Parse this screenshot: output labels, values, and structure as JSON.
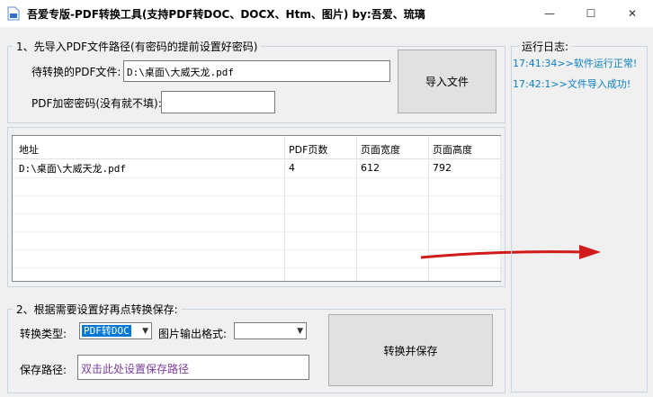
{
  "window": {
    "title": "吾爱专版-PDF转换工具(支持PDF转DOC、DOCX、Htm、图片) by:吾爱、琉璃",
    "minimize_glyph": "—",
    "maximize_glyph": "☐",
    "close_glyph": "✕"
  },
  "import_group": {
    "title": "1、先导入PDF文件路径(有密码的提前设置好密码)",
    "file_label": "待转换的PDF文件:",
    "file_value": "D:\\桌面\\大威天龙.pdf",
    "password_label": "PDF加密密码(没有就不填):",
    "password_value": "",
    "import_button": "导入文件"
  },
  "file_table": {
    "columns": [
      "地址",
      "PDF页数",
      "页面宽度",
      "页面高度"
    ],
    "rows": [
      [
        "D:\\桌面\\大威天龙.pdf",
        "4",
        "612",
        "792"
      ]
    ]
  },
  "convert_group": {
    "title": "2、根据需要设置好再点转换保存:",
    "type_label": "转换类型:",
    "type_value": "PDF转DOC",
    "image_format_label": "图片输出格式:",
    "image_format_value": "",
    "save_label": "保存路径:",
    "save_value": "双击此处设置保存路径",
    "convert_button": "转换并保存"
  },
  "log_group": {
    "title": "运行日志:",
    "lines": [
      "17:41:34>>软件运行正常!",
      "17:42:1>>文件导入成功!"
    ]
  },
  "colors": {
    "log_text": "#0a7fc4",
    "selected_bg": "#0078d7",
    "save_path_text": "#7a3e9d"
  }
}
